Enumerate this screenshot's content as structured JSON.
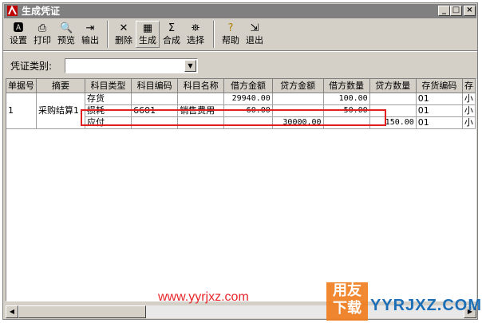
{
  "window": {
    "title": "生成凭证",
    "controls": {
      "minimize": "_",
      "maximize": "□",
      "close": "×"
    }
  },
  "toolbar": {
    "items": [
      {
        "label": "设置",
        "icon": "settings-icon"
      },
      {
        "label": "打印",
        "icon": "print-icon"
      },
      {
        "label": "预览",
        "icon": "preview-icon"
      },
      {
        "label": "输出",
        "icon": "export-icon"
      },
      {
        "label": "删除",
        "icon": "delete-icon"
      },
      {
        "label": "生成",
        "icon": "generate-icon"
      },
      {
        "label": "合成",
        "icon": "merge-icon"
      },
      {
        "label": "选择",
        "icon": "select-icon"
      },
      {
        "label": "帮助",
        "icon": "help-icon"
      },
      {
        "label": "退出",
        "icon": "exit-icon"
      }
    ]
  },
  "filter": {
    "label": "凭证类别:",
    "value": ""
  },
  "grid": {
    "columns": [
      "单据号",
      "摘要",
      "科目类型",
      "科目编码",
      "科目名称",
      "借方金额",
      "贷方金额",
      "借方数量",
      "贷方数量",
      "存货编码",
      "存"
    ],
    "group": {
      "doc_no": "1",
      "summary": "采购结算1"
    },
    "rows": [
      {
        "type": "存货",
        "code": "",
        "name": "",
        "debit": "29940.00",
        "credit": "",
        "debit_qty": "100.00",
        "credit_qty": "",
        "stock_code": "01",
        "extra": "小"
      },
      {
        "type": "损耗",
        "code": "6601",
        "name": "销售费用",
        "debit": "60.00",
        "credit": "",
        "debit_qty": "50.00",
        "credit_qty": "",
        "stock_code": "01",
        "extra": "小"
      },
      {
        "type": "应付",
        "code": "",
        "name": "",
        "debit": "",
        "credit": "30000.00",
        "debit_qty": "",
        "credit_qty": "150.00",
        "stock_code": "01",
        "extra": "小"
      }
    ]
  },
  "watermark": {
    "url": "www.yyrjxz.com",
    "logo_top": "用友",
    "logo_bottom": "下载",
    "brand": "YYRJXZ.COM"
  },
  "colors": {
    "title_bar": "#808080",
    "face": "#d4d0c8",
    "highlight_box": "#e02020"
  }
}
